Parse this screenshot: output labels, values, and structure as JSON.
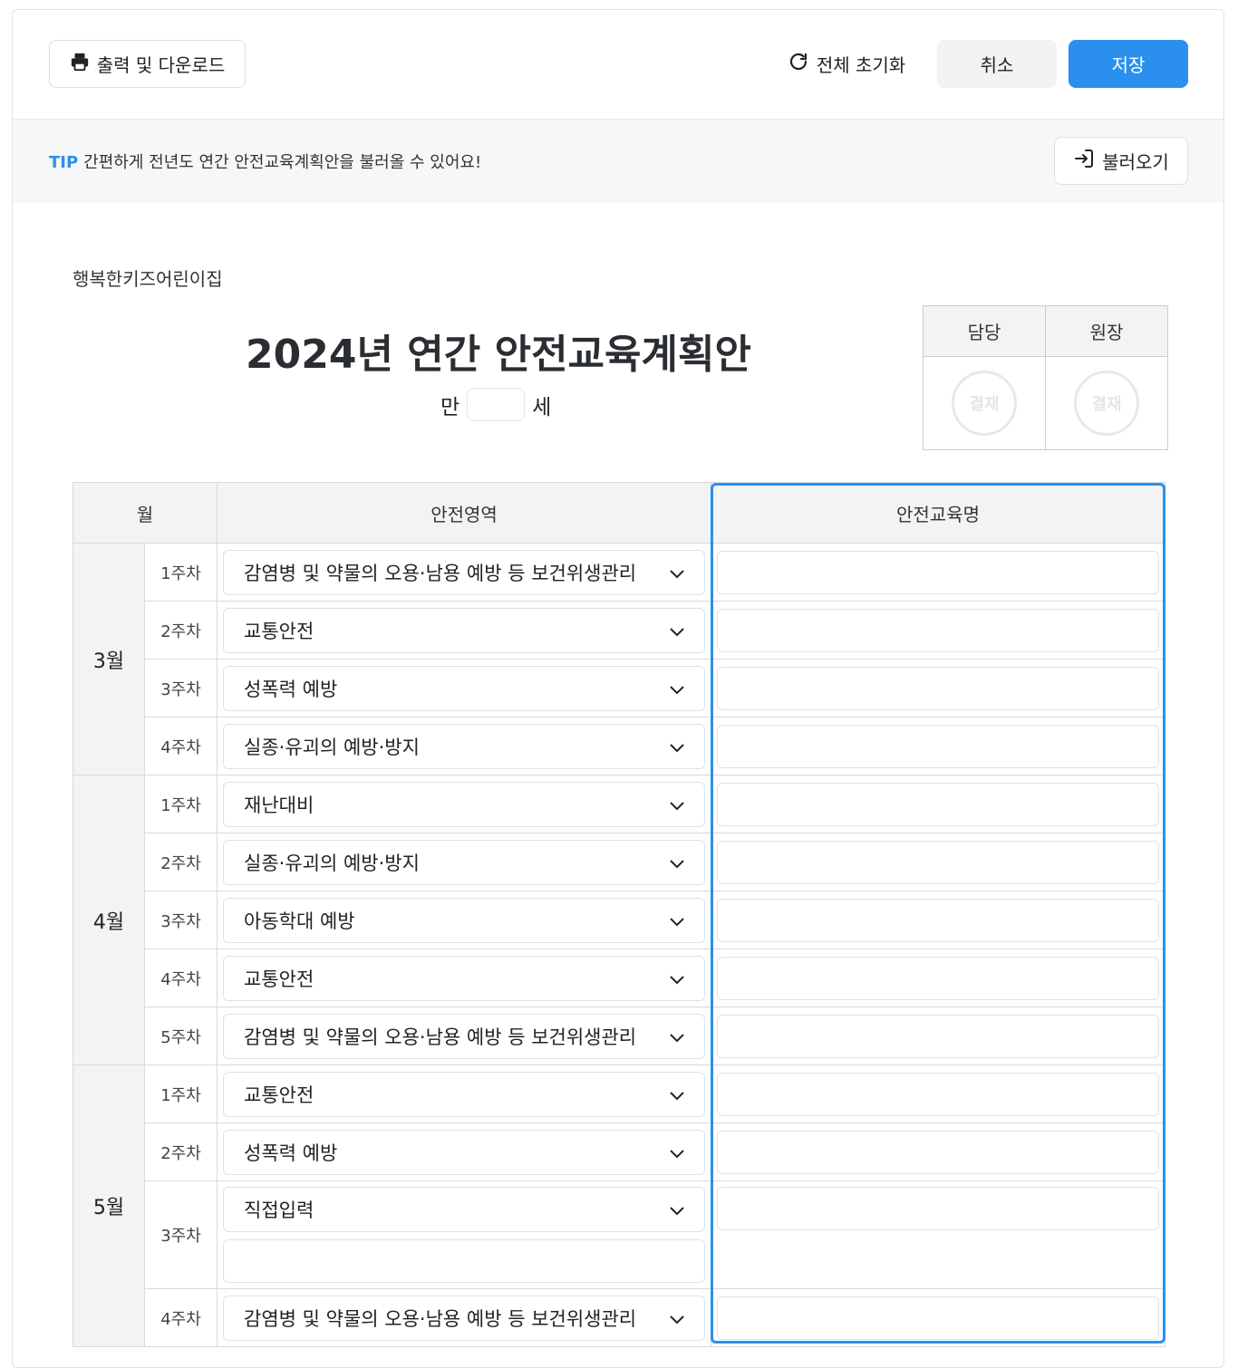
{
  "toolbar": {
    "print_label": "출력 및 다운로드",
    "reset_label": "전체 초기화",
    "cancel_label": "취소",
    "save_label": "저장"
  },
  "tip": {
    "label": "TIP",
    "text": "간편하게 전년도 연간 안전교육계획안을 불러올 수 있어요!",
    "load_label": "불러오기"
  },
  "document": {
    "daycare_name": "행복한키즈어린이집",
    "title": "2024년 연간 안전교육계획안",
    "age_prefix": "만",
    "age_suffix": "세"
  },
  "approval": {
    "headers": [
      "담당",
      "원장"
    ],
    "stamp_text": "결재"
  },
  "table": {
    "headers": [
      "월",
      "안전영역",
      "안전교육명"
    ],
    "months": [
      "3월",
      "4월",
      "5월"
    ],
    "rows": [
      {
        "week": "1주차",
        "area": "감염병 및 약물의 오용·남용 예방 등 보건위생관리"
      },
      {
        "week": "2주차",
        "area": "교통안전"
      },
      {
        "week": "3주차",
        "area": "성폭력 예방"
      },
      {
        "week": "4주차",
        "area": "실종·유괴의 예방·방지"
      },
      {
        "week": "1주차",
        "area": "재난대비"
      },
      {
        "week": "2주차",
        "area": "실종·유괴의 예방·방지"
      },
      {
        "week": "3주차",
        "area": "아동학대 예방"
      },
      {
        "week": "4주차",
        "area": "교통안전"
      },
      {
        "week": "5주차",
        "area": "감염병 및 약물의 오용·남용 예방 등 보건위생관리"
      },
      {
        "week": "1주차",
        "area": "교통안전"
      },
      {
        "week": "2주차",
        "area": "성폭력 예방"
      },
      {
        "week": "3주차",
        "area": "직접입력"
      },
      {
        "week": "4주차",
        "area": "감염병 및 약물의 오용·남용 예방 등 보건위생관리"
      }
    ]
  }
}
